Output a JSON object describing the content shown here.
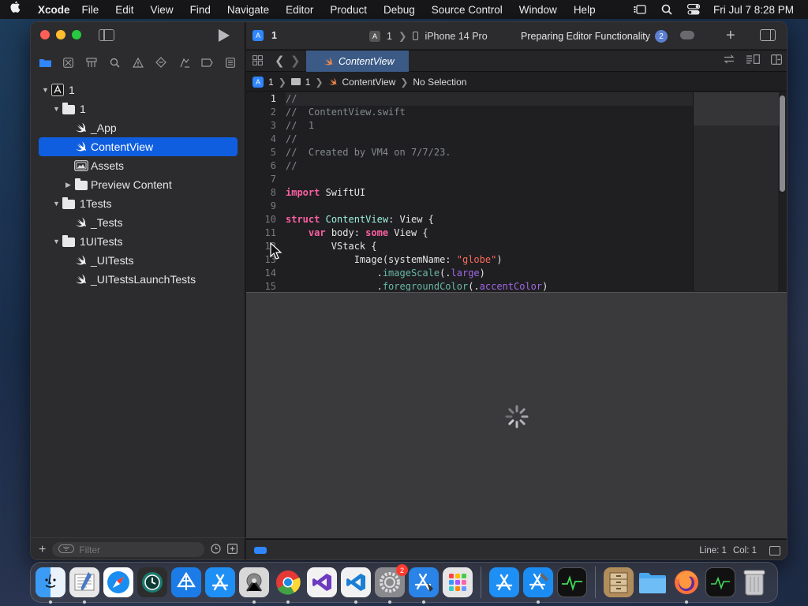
{
  "menubar": {
    "app_name": "Xcode",
    "items": [
      "File",
      "Edit",
      "View",
      "Find",
      "Navigate",
      "Editor",
      "Product",
      "Debug",
      "Source Control",
      "Window",
      "Help"
    ],
    "clock": "Fri Jul 7  8:28 PM"
  },
  "navigator": {
    "tree": [
      {
        "label": "1",
        "depth": 0,
        "icon": "project-icon",
        "disclosure": "open"
      },
      {
        "label": "1",
        "depth": 1,
        "icon": "folder-icon",
        "disclosure": "open"
      },
      {
        "label": "_App",
        "depth": 2,
        "icon": "swift-file-icon",
        "disclosure": "none"
      },
      {
        "label": "ContentView",
        "depth": 2,
        "icon": "swift-file-icon",
        "disclosure": "none",
        "selected": true
      },
      {
        "label": "Assets",
        "depth": 2,
        "icon": "asset-catalog-icon",
        "disclosure": "none"
      },
      {
        "label": "Preview Content",
        "depth": 2,
        "icon": "folder-icon",
        "disclosure": "closed"
      },
      {
        "label": "1Tests",
        "depth": 1,
        "icon": "folder-icon",
        "disclosure": "open"
      },
      {
        "label": "_Tests",
        "depth": 2,
        "icon": "swift-file-icon",
        "disclosure": "none"
      },
      {
        "label": "1UITests",
        "depth": 1,
        "icon": "folder-icon",
        "disclosure": "open"
      },
      {
        "label": "_UITests",
        "depth": 2,
        "icon": "swift-file-icon",
        "disclosure": "none"
      },
      {
        "label": "_UITestsLaunchTests",
        "depth": 2,
        "icon": "swift-file-icon",
        "disclosure": "none"
      }
    ],
    "filter_placeholder": "Filter"
  },
  "toolbar": {
    "project_name": "1",
    "scheme": "1",
    "device": "iPhone 14 Pro",
    "status": "Preparing Editor Functionality",
    "status_count": "2"
  },
  "tab": {
    "label": "ContentView"
  },
  "jumpbar": {
    "project": "1",
    "group": "1",
    "file": "ContentView",
    "symbol": "No Selection"
  },
  "code": {
    "current_line": 1,
    "lines": [
      {
        "n": "1",
        "tokens": [
          {
            "t": "//",
            "c": "comment"
          }
        ]
      },
      {
        "n": "2",
        "tokens": [
          {
            "t": "//  ContentView.swift",
            "c": "comment"
          }
        ]
      },
      {
        "n": "3",
        "tokens": [
          {
            "t": "//  1",
            "c": "comment"
          }
        ]
      },
      {
        "n": "4",
        "tokens": [
          {
            "t": "//",
            "c": "comment"
          }
        ]
      },
      {
        "n": "5",
        "tokens": [
          {
            "t": "//  Created by VM4 on 7/7/23.",
            "c": "comment"
          }
        ]
      },
      {
        "n": "6",
        "tokens": [
          {
            "t": "//",
            "c": "comment"
          }
        ]
      },
      {
        "n": "7",
        "tokens": []
      },
      {
        "n": "8",
        "tokens": [
          {
            "t": "import",
            "c": "kw"
          },
          {
            "t": " SwiftUI",
            "c": "plain"
          }
        ]
      },
      {
        "n": "9",
        "tokens": []
      },
      {
        "n": "10",
        "tokens": [
          {
            "t": "struct",
            "c": "kw"
          },
          {
            "t": " ",
            "c": "plain"
          },
          {
            "t": "ContentView",
            "c": "type"
          },
          {
            "t": ": View {",
            "c": "plain"
          }
        ]
      },
      {
        "n": "11",
        "tokens": [
          {
            "t": "    ",
            "c": "plain"
          },
          {
            "t": "var",
            "c": "kw"
          },
          {
            "t": " body: ",
            "c": "plain"
          },
          {
            "t": "some",
            "c": "kw"
          },
          {
            "t": " View {",
            "c": "plain"
          }
        ]
      },
      {
        "n": "12",
        "tokens": [
          {
            "t": "        VStack {",
            "c": "plain"
          }
        ]
      },
      {
        "n": "13",
        "tokens": [
          {
            "t": "            Image(systemName: ",
            "c": "plain"
          },
          {
            "t": "\"globe\"",
            "c": "str"
          },
          {
            "t": ")",
            "c": "plain"
          }
        ]
      },
      {
        "n": "14",
        "tokens": [
          {
            "t": "                .",
            "c": "plain"
          },
          {
            "t": "imageScale",
            "c": "fn"
          },
          {
            "t": "(.",
            "c": "plain"
          },
          {
            "t": "large",
            "c": "prop"
          },
          {
            "t": ")",
            "c": "plain"
          }
        ]
      },
      {
        "n": "15",
        "tokens": [
          {
            "t": "                .",
            "c": "plain"
          },
          {
            "t": "foregroundColor",
            "c": "fn"
          },
          {
            "t": "(.",
            "c": "plain"
          },
          {
            "t": "accentColor",
            "c": "prop"
          },
          {
            "t": ")",
            "c": "plain"
          }
        ]
      }
    ]
  },
  "statusbar": {
    "line": "Line: 1",
    "col": "Col: 1"
  },
  "dock": {
    "apps": [
      "finder-icon",
      "script-editor-icon",
      "safari-icon",
      "time-machine-icon",
      "instruments-icon",
      "app-store-icon",
      "system-utility-icon",
      "chrome-icon",
      "visual-studio-icon",
      "vscode-icon",
      "system-settings-icon",
      "simulator-icon",
      "launchpad-icon"
    ],
    "settings_badge": "2",
    "recent": [
      "app-store-icon",
      "xcode-icon",
      "activity-monitor-icon"
    ],
    "right": [
      "file-cabinet-icon",
      "folder-icon",
      "firefox-icon",
      "terminal-icon",
      "trash-icon"
    ]
  },
  "colors": {
    "accent": "#0f5ee0",
    "tab_active": "#3c5a86",
    "keyword": "#fc5fa3",
    "string": "#fc6a5d",
    "comment": "#848a8f"
  }
}
